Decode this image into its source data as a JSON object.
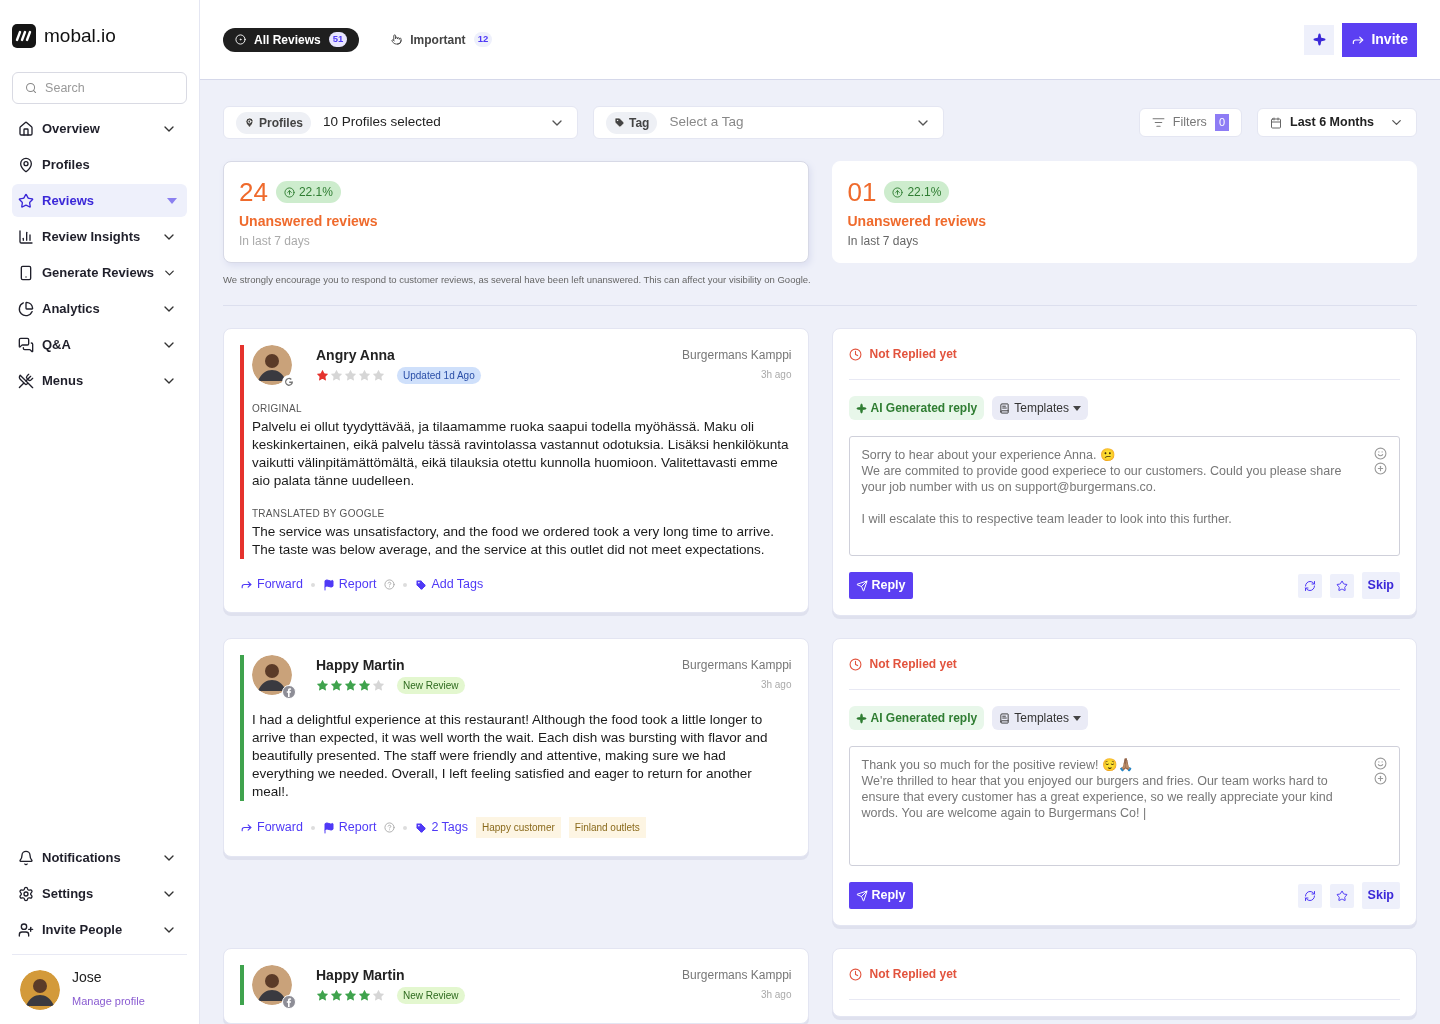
{
  "brand": {
    "name": "mobal.io"
  },
  "sidebar": {
    "search": {
      "placeholder": "Search"
    },
    "items": [
      {
        "label": "Overview",
        "selected": false,
        "has_submenu": true
      },
      {
        "label": "Profiles",
        "selected": false,
        "has_submenu": false
      },
      {
        "label": "Reviews",
        "selected": true,
        "has_submenu": true
      },
      {
        "label": "Review Insights",
        "selected": false,
        "has_submenu": true
      },
      {
        "label": "Generate Reviews",
        "selected": false,
        "has_submenu": true
      },
      {
        "label": "Analytics",
        "selected": false,
        "has_submenu": true
      },
      {
        "label": "Q&A",
        "selected": false,
        "has_submenu": true
      },
      {
        "label": "Menus",
        "selected": false,
        "has_submenu": true
      }
    ],
    "bottom_items": [
      {
        "label": "Notifications",
        "selected": false,
        "has_submenu": true
      },
      {
        "label": "Settings",
        "selected": false,
        "has_submenu": true
      },
      {
        "label": "Invite People",
        "selected": false,
        "has_submenu": true
      }
    ],
    "user": {
      "name": "Jose",
      "link": "Manage profile"
    }
  },
  "header": {
    "tabs": [
      {
        "label": "All Reviews",
        "count": "51",
        "selected": true
      },
      {
        "label": "Important",
        "count": "12",
        "selected": false
      }
    ],
    "invite_button": "Invite"
  },
  "filters": {
    "profiles": {
      "chip": "Profiles",
      "value": "10 Profiles selected"
    },
    "tag": {
      "chip": "Tag",
      "placeholder": "Select a Tag"
    },
    "filters_button": {
      "label": "Filters",
      "count": "0"
    },
    "date_range": "Last 6 Months"
  },
  "stats": [
    {
      "value": "24",
      "change": "22.1%",
      "label": "Unanswered reviews",
      "period": "In last 7 days",
      "selected": true
    },
    {
      "value": "01",
      "change": "22.1%",
      "label": "Unanswered reviews",
      "period": "In last 7 days",
      "selected": false
    }
  ],
  "notice": "We strongly encourage you to respond to customer reviews, as several have been left unanswered. This can affect your visibility on Google.",
  "reviews": [
    {
      "author": "Angry Anna",
      "kind": "google",
      "stars": 1,
      "color": "#e5322d",
      "badge": {
        "text": "Updated 1d Ago",
        "kind": "updated"
      },
      "location": "Burgermans Kamppi",
      "time": "3h ago",
      "sections": [
        {
          "heading": "ORIGINAL",
          "text": "Palvelu ei ollut tyydyttävää, ja tilaamamme ruoka saapui todella myöhässä. Maku oli keskinkertainen, eikä palvelu tässä ravintolassa vastannut odotuksia. Lisäksi henkilökunta vaikutti välinpitämättömältä, eikä tilauksia otettu kunnolla huomioon. Valitettavasti emme aio palata tänne uudelleen."
        },
        {
          "heading": "TRANSLATED BY GOOGLE",
          "text": "The service was unsatisfactory, and the food we ordered took a very long time to arrive. The taste was below average, and the service at this outlet did not meet expectations."
        }
      ],
      "actions": {
        "forward": "Forward",
        "report": "Report",
        "tags_label": "Add Tags"
      },
      "reply": {
        "status": "Not Replied yet",
        "ai_label": "AI Generated reply",
        "templates": "Templates",
        "text": "Sorry to hear about your experience Anna. 😕\nWe are commited to provide good experiece to our customers. Could you please share your job number with us on support@burgermans.co.\n\nI will escalate this to respective team leader to look into this further.",
        "reply_button": "Reply",
        "skip_button": "Skip"
      }
    },
    {
      "author": "Happy Martin",
      "kind": "facebook",
      "stars": 4,
      "color": "#3fa34d",
      "badge": {
        "text": "New Review",
        "kind": "new"
      },
      "location": "Burgermans Kamppi",
      "time": "3h ago",
      "sections": [
        {
          "text": "I had a delightful experience at this restaurant! Although the food took a little longer to arrive than expected, it was well worth the wait. Each dish was bursting with flavor and beautifully presented. The staff were friendly and attentive, making sure we had everything we needed. Overall, I left feeling satisfied and eager to return for another meal!."
        }
      ],
      "actions": {
        "forward": "Forward",
        "report": "Report",
        "tags_label": "2 Tags",
        "tags": [
          "Happy customer",
          "Finland outlets"
        ]
      },
      "reply": {
        "status": "Not Replied yet",
        "ai_label": "AI Generated reply",
        "templates": "Templates",
        "text": "Thank you so much for the positive review! 😌🙏🏽\nWe're thrilled to hear that you enjoyed our burgers and fries. Our team works hard to ensure that every customer has a great experience, so we really appreciate your kind words. You are welcome again to Burgermans Co! |",
        "reply_button": "Reply",
        "skip_button": "Skip"
      }
    },
    {
      "author": "Happy Martin",
      "kind": "facebook",
      "stars": 4,
      "color": "#3fa34d",
      "badge": {
        "text": "New Review",
        "kind": "new"
      },
      "location": "Burgermans Kamppi",
      "time": "3h ago",
      "reply": {
        "status": "Not Replied yet"
      }
    }
  ]
}
